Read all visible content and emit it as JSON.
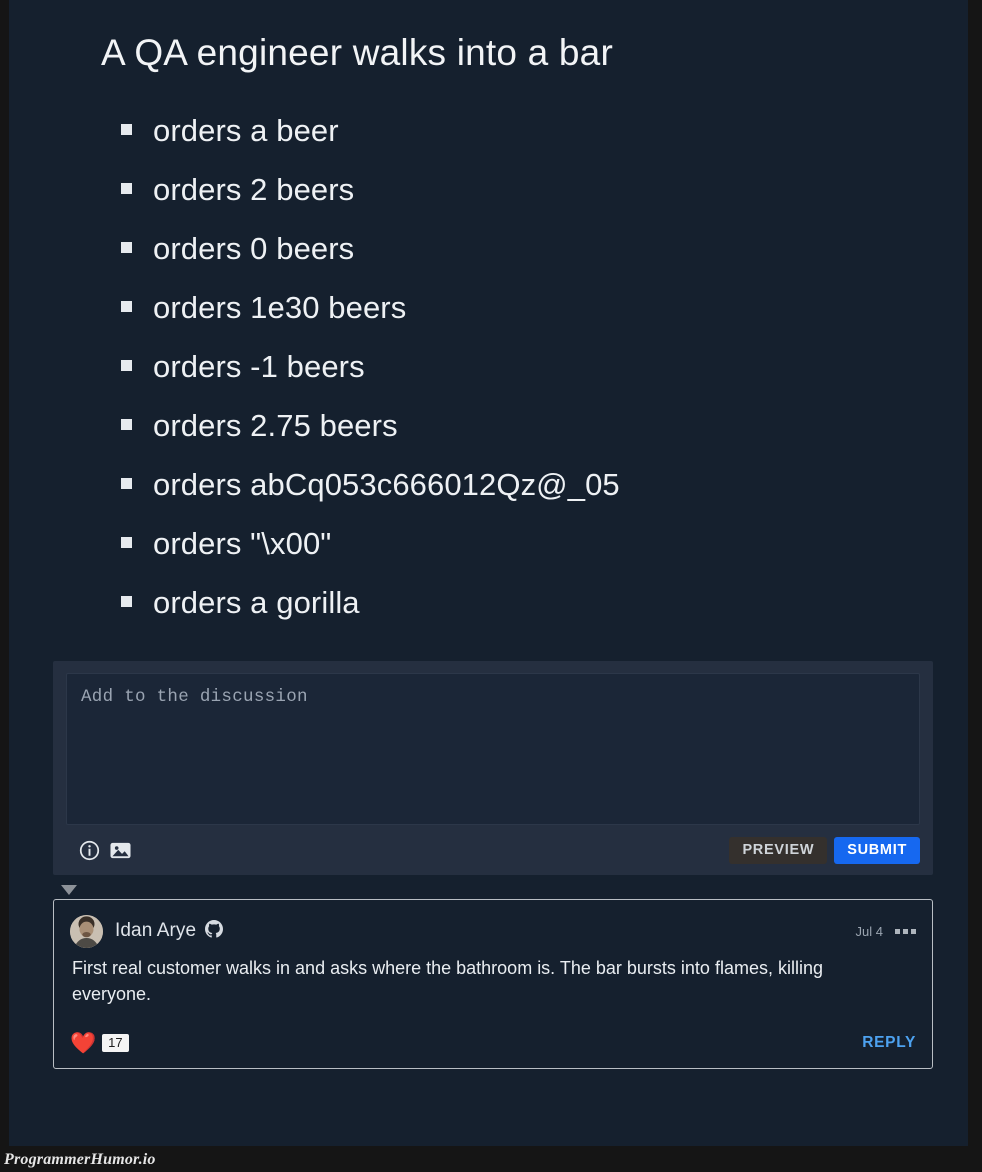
{
  "post": {
    "title": "A QA engineer walks into a bar",
    "bullets": [
      "orders a beer",
      "orders 2 beers",
      "orders 0 beers",
      "orders 1e30 beers",
      "orders -1 beers",
      "orders 2.75 beers",
      "orders abCq053c666012Qz@_05",
      "orders \"\\x00\"",
      "orders a gorilla"
    ]
  },
  "composer": {
    "placeholder": "Add to the discussion",
    "value": "",
    "info_icon": "info-icon",
    "image_icon": "image-icon",
    "preview_label": "PREVIEW",
    "submit_label": "SUBMIT",
    "preview_bg": "#34302d",
    "submit_bg": "#1668f0"
  },
  "comment": {
    "author": "Idan Arye",
    "provider_icon": "github-icon",
    "date": "Jul 4",
    "menu_icon": "kebab-menu-icon",
    "body": "First real customer walks in and asks where the bathroom is. The bar bursts into flames, killing everyone.",
    "reaction": {
      "emoji": "❤️",
      "name": "heart-reaction",
      "count": "17"
    },
    "reply_label": "REPLY",
    "reply_color": "#4da2f0"
  },
  "footer": {
    "watermark": "ProgrammerHumor.io"
  },
  "theme": {
    "background": "#15202e",
    "gutter": "#151515",
    "composer_bg": "#252f40",
    "textarea_bg": "#1b2637",
    "text": "#eef1f4"
  }
}
